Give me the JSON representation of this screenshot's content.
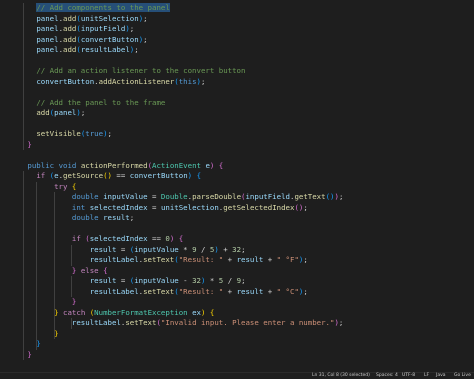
{
  "editor": {
    "lines": [
      [
        {
          "t": "    "
        },
        {
          "t": "// Add components to the panel",
          "c": "com",
          "sel": true
        }
      ],
      [
        {
          "t": "    "
        },
        {
          "t": "panel",
          "c": "var"
        },
        {
          "t": "."
        },
        {
          "t": "add",
          "c": "fn"
        },
        {
          "t": "(",
          "c": "b3"
        },
        {
          "t": "unitSelection",
          "c": "var"
        },
        {
          "t": ")",
          "c": "b3"
        },
        {
          "t": ";"
        }
      ],
      [
        {
          "t": "    "
        },
        {
          "t": "panel",
          "c": "var"
        },
        {
          "t": "."
        },
        {
          "t": "add",
          "c": "fn"
        },
        {
          "t": "(",
          "c": "b3"
        },
        {
          "t": "inputField",
          "c": "var"
        },
        {
          "t": ")",
          "c": "b3"
        },
        {
          "t": ";"
        }
      ],
      [
        {
          "t": "    "
        },
        {
          "t": "panel",
          "c": "var"
        },
        {
          "t": "."
        },
        {
          "t": "add",
          "c": "fn"
        },
        {
          "t": "(",
          "c": "b3"
        },
        {
          "t": "convertButton",
          "c": "var"
        },
        {
          "t": ")",
          "c": "b3"
        },
        {
          "t": ";"
        }
      ],
      [
        {
          "t": "    "
        },
        {
          "t": "panel",
          "c": "var"
        },
        {
          "t": "."
        },
        {
          "t": "add",
          "c": "fn"
        },
        {
          "t": "(",
          "c": "b3"
        },
        {
          "t": "resultLabel",
          "c": "var"
        },
        {
          "t": ")",
          "c": "b3"
        },
        {
          "t": ";"
        }
      ],
      [],
      [
        {
          "t": "    "
        },
        {
          "t": "// Add an action listener to the convert button",
          "c": "com"
        }
      ],
      [
        {
          "t": "    "
        },
        {
          "t": "convertButton",
          "c": "var"
        },
        {
          "t": "."
        },
        {
          "t": "addActionListener",
          "c": "fn"
        },
        {
          "t": "(",
          "c": "b3"
        },
        {
          "t": "this",
          "c": "kw"
        },
        {
          "t": ")",
          "c": "b3"
        },
        {
          "t": ";"
        }
      ],
      [],
      [
        {
          "t": "    "
        },
        {
          "t": "// Add the panel to the frame",
          "c": "com"
        }
      ],
      [
        {
          "t": "    "
        },
        {
          "t": "add",
          "c": "fn"
        },
        {
          "t": "(",
          "c": "b3"
        },
        {
          "t": "panel",
          "c": "var"
        },
        {
          "t": ")",
          "c": "b3"
        },
        {
          "t": ";"
        }
      ],
      [],
      [
        {
          "t": "    "
        },
        {
          "t": "setVisible",
          "c": "fn"
        },
        {
          "t": "(",
          "c": "b3"
        },
        {
          "t": "true",
          "c": "kw"
        },
        {
          "t": ")",
          "c": "b3"
        },
        {
          "t": ";"
        }
      ],
      [
        {
          "t": "  "
        },
        {
          "t": "}",
          "c": "b2"
        }
      ],
      [],
      [
        {
          "t": "  "
        },
        {
          "t": "public",
          "c": "kw"
        },
        {
          "t": " "
        },
        {
          "t": "void",
          "c": "kw"
        },
        {
          "t": " "
        },
        {
          "t": "actionPerformed",
          "c": "fn"
        },
        {
          "t": "(",
          "c": "b2"
        },
        {
          "t": "ActionEvent",
          "c": "type"
        },
        {
          "t": " "
        },
        {
          "t": "e",
          "c": "var"
        },
        {
          "t": ")",
          "c": "b2"
        },
        {
          "t": " "
        },
        {
          "t": "{",
          "c": "b2"
        }
      ],
      [
        {
          "t": "    "
        },
        {
          "t": "if",
          "c": "ctl"
        },
        {
          "t": " "
        },
        {
          "t": "(",
          "c": "b3"
        },
        {
          "t": "e",
          "c": "var"
        },
        {
          "t": "."
        },
        {
          "t": "getSource",
          "c": "fn"
        },
        {
          "t": "(",
          "c": "b1"
        },
        {
          "t": ")",
          "c": "b1"
        },
        {
          "t": " == "
        },
        {
          "t": "convertButton",
          "c": "var"
        },
        {
          "t": ")",
          "c": "b3"
        },
        {
          "t": " "
        },
        {
          "t": "{",
          "c": "b3"
        }
      ],
      [
        {
          "t": "        "
        },
        {
          "t": "try",
          "c": "ctl"
        },
        {
          "t": " "
        },
        {
          "t": "{",
          "c": "b1"
        }
      ],
      [
        {
          "t": "            "
        },
        {
          "t": "double",
          "c": "kw"
        },
        {
          "t": " "
        },
        {
          "t": "inputValue",
          "c": "var"
        },
        {
          "t": " = "
        },
        {
          "t": "Double",
          "c": "type"
        },
        {
          "t": "."
        },
        {
          "t": "parseDouble",
          "c": "fn"
        },
        {
          "t": "(",
          "c": "b2"
        },
        {
          "t": "inputField",
          "c": "var"
        },
        {
          "t": "."
        },
        {
          "t": "getText",
          "c": "fn"
        },
        {
          "t": "(",
          "c": "b3"
        },
        {
          "t": ")",
          "c": "b3"
        },
        {
          "t": ")",
          "c": "b2"
        },
        {
          "t": ";"
        }
      ],
      [
        {
          "t": "            "
        },
        {
          "t": "int",
          "c": "kw"
        },
        {
          "t": " "
        },
        {
          "t": "selectedIndex",
          "c": "var"
        },
        {
          "t": " = "
        },
        {
          "t": "unitSelection",
          "c": "var"
        },
        {
          "t": "."
        },
        {
          "t": "getSelectedIndex",
          "c": "fn"
        },
        {
          "t": "(",
          "c": "b2"
        },
        {
          "t": ")",
          "c": "b2"
        },
        {
          "t": ";"
        }
      ],
      [
        {
          "t": "            "
        },
        {
          "t": "double",
          "c": "kw"
        },
        {
          "t": " "
        },
        {
          "t": "result",
          "c": "var"
        },
        {
          "t": ";"
        }
      ],
      [],
      [
        {
          "t": "            "
        },
        {
          "t": "if",
          "c": "ctl"
        },
        {
          "t": " "
        },
        {
          "t": "(",
          "c": "b2"
        },
        {
          "t": "selectedIndex",
          "c": "var"
        },
        {
          "t": " == "
        },
        {
          "t": "0",
          "c": "num"
        },
        {
          "t": ")",
          "c": "b2"
        },
        {
          "t": " "
        },
        {
          "t": "{",
          "c": "b2"
        }
      ],
      [
        {
          "t": "                "
        },
        {
          "t": "result",
          "c": "var"
        },
        {
          "t": " = "
        },
        {
          "t": "(",
          "c": "b3"
        },
        {
          "t": "inputValue",
          "c": "var"
        },
        {
          "t": " * "
        },
        {
          "t": "9",
          "c": "num"
        },
        {
          "t": " / "
        },
        {
          "t": "5",
          "c": "num"
        },
        {
          "t": ")",
          "c": "b3"
        },
        {
          "t": " + "
        },
        {
          "t": "32",
          "c": "num"
        },
        {
          "t": ";"
        }
      ],
      [
        {
          "t": "                "
        },
        {
          "t": "resultLabel",
          "c": "var"
        },
        {
          "t": "."
        },
        {
          "t": "setText",
          "c": "fn"
        },
        {
          "t": "(",
          "c": "b3"
        },
        {
          "t": "\"Result: \"",
          "c": "str"
        },
        {
          "t": " + "
        },
        {
          "t": "result",
          "c": "var"
        },
        {
          "t": " + "
        },
        {
          "t": "\" °F\"",
          "c": "str"
        },
        {
          "t": ")",
          "c": "b3"
        },
        {
          "t": ";"
        }
      ],
      [
        {
          "t": "            "
        },
        {
          "t": "}",
          "c": "b2"
        },
        {
          "t": " "
        },
        {
          "t": "else",
          "c": "ctl"
        },
        {
          "t": " "
        },
        {
          "t": "{",
          "c": "b2"
        }
      ],
      [
        {
          "t": "                "
        },
        {
          "t": "result",
          "c": "var"
        },
        {
          "t": " = "
        },
        {
          "t": "(",
          "c": "b3"
        },
        {
          "t": "inputValue",
          "c": "var"
        },
        {
          "t": " - "
        },
        {
          "t": "32",
          "c": "num"
        },
        {
          "t": ")",
          "c": "b3"
        },
        {
          "t": " * "
        },
        {
          "t": "5",
          "c": "num"
        },
        {
          "t": " / "
        },
        {
          "t": "9",
          "c": "num"
        },
        {
          "t": ";"
        }
      ],
      [
        {
          "t": "                "
        },
        {
          "t": "resultLabel",
          "c": "var"
        },
        {
          "t": "."
        },
        {
          "t": "setText",
          "c": "fn"
        },
        {
          "t": "(",
          "c": "b3"
        },
        {
          "t": "\"Result: \"",
          "c": "str"
        },
        {
          "t": " + "
        },
        {
          "t": "result",
          "c": "var"
        },
        {
          "t": " + "
        },
        {
          "t": "\" °C\"",
          "c": "str"
        },
        {
          "t": ")",
          "c": "b3"
        },
        {
          "t": ";"
        }
      ],
      [
        {
          "t": "            "
        },
        {
          "t": "}",
          "c": "b2"
        }
      ],
      [
        {
          "t": "        "
        },
        {
          "t": "}",
          "c": "b1"
        },
        {
          "t": " "
        },
        {
          "t": "catch",
          "c": "ctl"
        },
        {
          "t": " "
        },
        {
          "t": "(",
          "c": "b1"
        },
        {
          "t": "NumberFormatException",
          "c": "type"
        },
        {
          "t": " "
        },
        {
          "t": "ex",
          "c": "var"
        },
        {
          "t": ")",
          "c": "b1"
        },
        {
          "t": " "
        },
        {
          "t": "{",
          "c": "b1"
        }
      ],
      [
        {
          "t": "            "
        },
        {
          "t": "resultLabel",
          "c": "var"
        },
        {
          "t": "."
        },
        {
          "t": "setText",
          "c": "fn"
        },
        {
          "t": "(",
          "c": "b2"
        },
        {
          "t": "\"Invalid input. Please enter a number.\"",
          "c": "str"
        },
        {
          "t": ")",
          "c": "b2"
        },
        {
          "t": ";"
        }
      ],
      [
        {
          "t": "        "
        },
        {
          "t": "}",
          "c": "b1"
        }
      ],
      [
        {
          "t": "    "
        },
        {
          "t": "}",
          "c": "b3"
        }
      ],
      [
        {
          "t": "  "
        },
        {
          "t": "}",
          "c": "b2"
        }
      ],
      [],
      [
        {
          "t": "  "
        },
        {
          "t": "public",
          "c": "kw"
        },
        {
          "t": " "
        },
        {
          "t": "static",
          "c": "kw"
        },
        {
          "t": " "
        },
        {
          "t": "void",
          "c": "kw"
        },
        {
          "t": " "
        },
        {
          "t": "main",
          "c": "fn"
        },
        {
          "t": "(",
          "c": "b2"
        },
        {
          "t": "String",
          "c": "type"
        },
        {
          "t": "[]"
        },
        {
          "t": " "
        },
        {
          "t": "args",
          "c": "var"
        },
        {
          "t": ")",
          "c": "b2"
        },
        {
          "t": " "
        },
        {
          "t": "{",
          "c": "b2"
        }
      ]
    ]
  },
  "status_bar": {
    "cursor_position": "Ln 31, Col 8 (30 selected)",
    "indentation": "Spaces: 4",
    "encoding": "UTF-8",
    "eol": "LF",
    "language": "Java",
    "live_share": "Go Live"
  }
}
